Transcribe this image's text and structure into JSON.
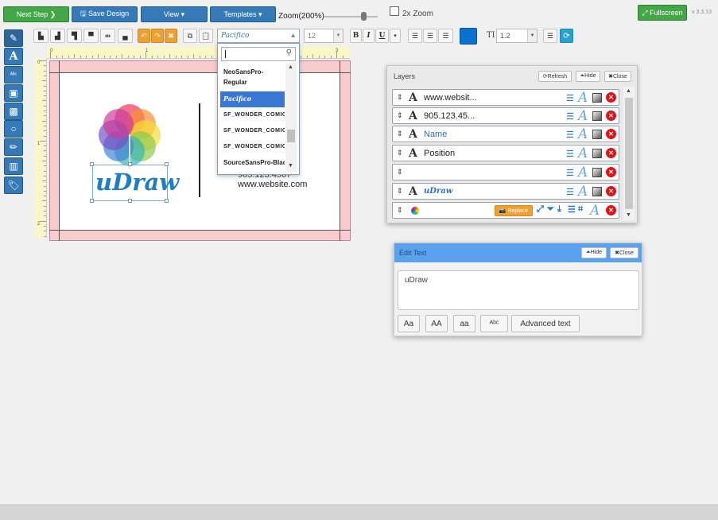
{
  "topbar": {
    "next_step": "Next Step ❯",
    "save_design": "🖫 Save Design",
    "view": "View ▾",
    "templates": "Templates ▾",
    "zoom": "Zoom(200%)",
    "zoom_level": 0.75,
    "double_zoom": "2x Zoom",
    "fullscreen": "⤢ Fullscreen",
    "version": "v 3.3.13"
  },
  "left_tools": [
    {
      "name": "edit-tool",
      "glyph": "✎"
    },
    {
      "name": "text-tool",
      "glyph": "A"
    },
    {
      "name": "curved-text-tool",
      "glyph": "ᴬᴮᶜ"
    },
    {
      "name": "image-tool",
      "glyph": "▣"
    },
    {
      "name": "qr-code-tool",
      "glyph": "▩"
    },
    {
      "name": "shape-tool",
      "glyph": "○"
    },
    {
      "name": "draw-tool",
      "glyph": "✏"
    },
    {
      "name": "barcode-tool",
      "glyph": "▥"
    },
    {
      "name": "tags-tool",
      "glyph": "🏷"
    }
  ],
  "toolbar": {
    "undo": "↶",
    "redo": "↷",
    "clear": "✖",
    "font_name": "Pacifico",
    "font_size": "12",
    "bold": "B",
    "italic": "I",
    "underline": "U",
    "more": "▾",
    "color": "#0a71d1",
    "spacing_label": "TI",
    "spacing_value": "1.2",
    "list": "☰",
    "refresh": "⟳"
  },
  "ruler": {
    "h_numbers": [
      "0",
      "1",
      "2",
      "3"
    ],
    "v_numbers": [
      "0",
      "1",
      "2"
    ]
  },
  "canvas": {
    "logo_text": "uDraw",
    "phone": "905.123.4567",
    "website": "www.website.com"
  },
  "font_dropdown": {
    "search_value": "",
    "items": [
      {
        "label": "NeoSansPro-Regular",
        "selected": false
      },
      {
        "label": "Pacifico",
        "selected": true
      },
      {
        "label": "SF_WONDER_COMIC",
        "selected": false
      },
      {
        "label": "SF_WONDER_COMIC",
        "selected": false
      },
      {
        "label": "SF_WONDER_COMIC",
        "selected": false
      },
      {
        "label": "SourceSansPro-Black",
        "selected": false
      }
    ]
  },
  "layers": {
    "title": "Layers",
    "refresh": "⟳Refresh",
    "hide": "⏶Hide",
    "close": "✖Close",
    "rows": [
      {
        "type": "A",
        "label": "www.websit...",
        "style": "plain"
      },
      {
        "type": "A",
        "label": "905.123.45...",
        "style": "plain"
      },
      {
        "type": "A",
        "label": "Name",
        "style": "blue"
      },
      {
        "type": "A",
        "label": "Position",
        "style": "plain"
      },
      {
        "type": "",
        "label": "",
        "style": "plain"
      },
      {
        "type": "A",
        "label": "uDraw",
        "style": "script"
      },
      {
        "type": "",
        "label": "",
        "style": "image",
        "replace": "📷 Replace"
      }
    ]
  },
  "edit_text": {
    "title": "Edit Text",
    "hide": "⏶Hide",
    "close": "✖Close",
    "value": "uDraw",
    "case_buttons": [
      "Aa",
      "AA",
      "aa",
      "ᴬᵇᶜ"
    ],
    "advanced": "Advanced text"
  }
}
